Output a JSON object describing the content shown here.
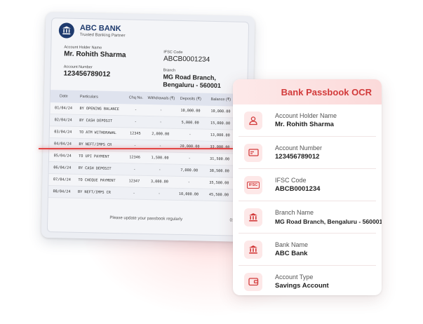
{
  "passbook": {
    "bank_name": "ABC BANK",
    "bank_tagline": "Trusted Banking Partner",
    "holder_label": "Account Holder Name",
    "holder_value": "Mr. Rohith Sharma",
    "ifsc_label": "IFSC Code",
    "ifsc_value": "ABCB0001234",
    "account_label": "Account Number",
    "account_value": "123456789012",
    "branch_label": "Branch",
    "branch_line1": "MG Road Branch,",
    "branch_line2": "Bengaluru - 560001",
    "columns": [
      "Date",
      "Particulars",
      "Chq No.",
      "Withdrawals (₹)",
      "Deposits (₹)",
      "Balance (₹)"
    ],
    "rows": [
      [
        "01/04/24",
        "BY OPENING BALANCE",
        "-",
        "-",
        "10,000.00",
        "10,000.00"
      ],
      [
        "02/04/24",
        "BY CASH DEPOSIT",
        "-",
        "-",
        "5,000.00",
        "15,000.00"
      ],
      [
        "03/04/24",
        "TO ATM WITHDRAWAL",
        "12345",
        "2,000.00",
        "-",
        "13,000.00"
      ],
      [
        "04/04/24",
        "BY NEFT/IMPS CR",
        "-",
        "-",
        "20,000.00",
        "33,000.00"
      ],
      [
        "05/04/24",
        "TO UPI PAYMENT",
        "12346",
        "1,500.00",
        "-",
        "31,500.00"
      ],
      [
        "06/04/24",
        "BY CASH DEPOSIT",
        "-",
        "-",
        "7,000.00",
        "38,500.00"
      ],
      [
        "07/04/24",
        "TO CHEQUE PAYMENT",
        "12347",
        "3,000.00",
        "-",
        "35,500.00"
      ],
      [
        "08/04/24",
        "BY NEFT/IMPS CR",
        "-",
        "-",
        "10,000.00",
        "45,500.00"
      ]
    ],
    "footer_text": "Please update your passbook regularly",
    "page_number": "01"
  },
  "ocr": {
    "title": "Bank Passbook OCR",
    "fields": [
      {
        "label": "Account Holder Name",
        "value": "Mr. Rohith Sharma",
        "icon": "user-icon"
      },
      {
        "label": "Account Number",
        "value": "123456789012",
        "icon": "card-icon"
      },
      {
        "label": "IFSC Code",
        "value": "ABCB0001234",
        "icon": "ifsc-icon"
      },
      {
        "label": "Branch Name",
        "value": "MG Road Branch, Bengaluru - 560001",
        "icon": "bank-building-icon"
      },
      {
        "label": "Bank Name",
        "value": "ABC Bank",
        "icon": "bank-building-icon"
      },
      {
        "label": "Account Type",
        "value": "Savings Account",
        "icon": "wallet-icon"
      }
    ],
    "ifsc_icon_text": "IFSC"
  },
  "colors": {
    "accent": "#d23a3a",
    "bank_navy": "#1f3b6e",
    "scan_line": "#e24646"
  }
}
